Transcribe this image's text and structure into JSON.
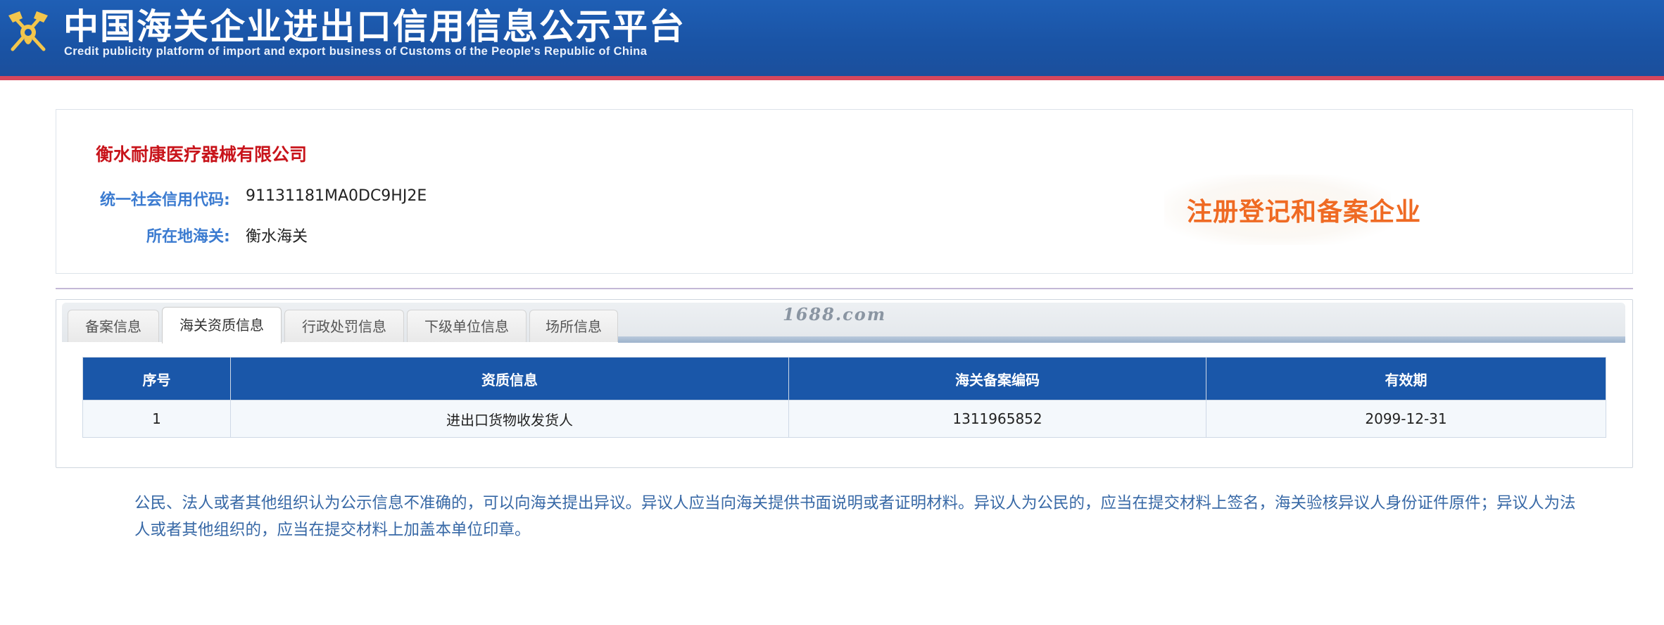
{
  "header": {
    "title": "中国海关企业进出口信用信息公示平台",
    "subtitle": "Credit publicity platform of import and export business of Customs of the People's Republic of China",
    "emblem_icon": "customs-emblem-icon",
    "bg_color": "#1a54a6",
    "stripe_color": "#d6475c"
  },
  "company": {
    "name": "衡水耐康医疗器械有限公司",
    "credit_code_label": "统一社会信用代码:",
    "credit_code_value": "91131181MA0DC9HJ2E",
    "customs_label": "所在地海关:",
    "customs_value": "衡水海关",
    "registration_status": "注册登记和备案企业",
    "name_color": "#c8141b",
    "status_color": "#ef6a23"
  },
  "tabs": [
    {
      "label": "备案信息",
      "active": false
    },
    {
      "label": "海关资质信息",
      "active": true
    },
    {
      "label": "行政处罚信息",
      "active": false
    },
    {
      "label": "下级单位信息",
      "active": false
    },
    {
      "label": "场所信息",
      "active": false
    }
  ],
  "watermark": "1688.com",
  "qualification_table": {
    "columns": [
      "序号",
      "资质信息",
      "海关备案编码",
      "有效期"
    ],
    "rows": [
      [
        "1",
        "进出口货物收发货人",
        "1311965852",
        "2099-12-31"
      ]
    ],
    "header_color": "#1a57a9"
  },
  "notice": "公民、法人或者其他组织认为公示信息不准确的，可以向海关提出异议。异议人应当向海关提供书面说明或者证明材料。异议人为公民的，应当在提交材料上签名，海关验核异议人身份证件原件；异议人为法人或者其他组织的，应当在提交材料上加盖本单位印章。"
}
